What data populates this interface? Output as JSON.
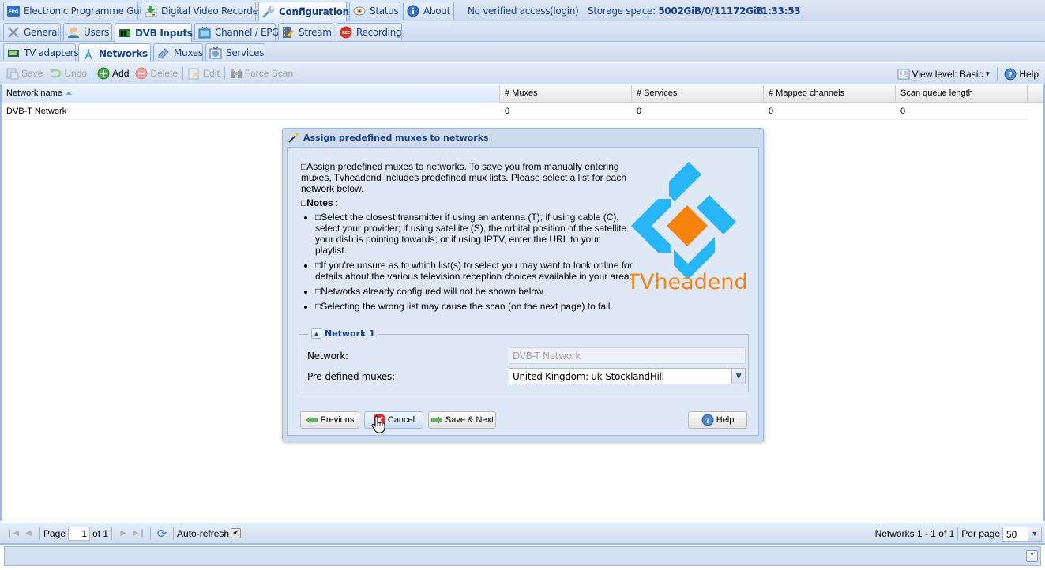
{
  "top_tabs": [
    {
      "label": "Electronic Programme Guide",
      "icon": "epg-icon",
      "active": false
    },
    {
      "label": "Digital Video Recorder",
      "icon": "download-icon",
      "active": false
    },
    {
      "label": "Configuration",
      "icon": "wrench-icon",
      "active": true
    },
    {
      "label": "Status",
      "icon": "eye-icon",
      "active": false
    },
    {
      "label": "About",
      "icon": "info-icon",
      "active": false
    }
  ],
  "status_bar": {
    "access": "No verified access",
    "login": "(login)",
    "storage_label": "Storage space:",
    "storage_value": "5002GiB/0/11172GiB",
    "time": "11:33:53"
  },
  "config_tabs": [
    {
      "label": "General",
      "icon": "tools-icon",
      "active": false
    },
    {
      "label": "Users",
      "icon": "users-icon",
      "active": false
    },
    {
      "label": "DVB Inputs",
      "icon": "dvb-card-icon",
      "active": true
    },
    {
      "label": "Channel / EPG",
      "icon": "tv-icon",
      "active": false
    },
    {
      "label": "Stream",
      "icon": "film-icon",
      "active": false
    },
    {
      "label": "Recording",
      "icon": "rec-icon",
      "active": false
    }
  ],
  "dvb_tabs": [
    {
      "label": "TV adapters",
      "icon": "adapter-icon",
      "active": false
    },
    {
      "label": "Networks",
      "icon": "antenna-icon",
      "active": true
    },
    {
      "label": "Muxes",
      "icon": "mux-icon",
      "active": false
    },
    {
      "label": "Services",
      "icon": "services-icon",
      "active": false
    }
  ],
  "toolbar": {
    "save": "Save",
    "undo": "Undo",
    "add": "Add",
    "delete": "Delete",
    "edit": "Edit",
    "force_scan": "Force Scan",
    "view_level": "View level: Basic",
    "help": "Help"
  },
  "grid": {
    "columns": [
      "Network name",
      "# Muxes",
      "# Services",
      "# Mapped channels",
      "Scan queue length"
    ],
    "sorted_column": "Network name",
    "rows": [
      [
        "DVB-T Network",
        "0",
        "0",
        "0",
        "0"
      ]
    ]
  },
  "paging": {
    "page_label": "Page",
    "page_value": "1",
    "of_label": "of 1",
    "auto_refresh": "Auto-refresh",
    "auto_refresh_checked": true,
    "summary": "Networks 1 - 1 of 1",
    "per_page_label": "Per page",
    "per_page_value": "50"
  },
  "dialog": {
    "title": "Assign predefined muxes to networks",
    "intro": "□Assign predefined muxes to networks. To save you from manually entering muxes, Tvheadend includes predefined mux lists. Please select a list for each network below.",
    "notes_prefix": "□",
    "notes_label": "Notes",
    "notes_suffix": " :",
    "notes": [
      "□Select the closest transmitter if using an antenna (T); if using cable (C), select your provider; if using satellite (S), the orbital position of the satellite your dish is pointing towards; or if using IPTV, enter the URL to your playlist.",
      "□If you're unsure as to which list(s) to select you may want to look online for details about the various television reception choices available in your area.",
      "□Networks already configured will not be shown below.",
      "□Selecting the wrong list may cause the scan (on the next page) to fail."
    ],
    "logo_text": "TVheadend",
    "fieldset_title": "Network 1",
    "network_label": "Network:",
    "network_value": "DVB-T Network",
    "muxes_label": "Pre-defined muxes:",
    "muxes_value": "United Kingdom: uk-StocklandHill",
    "buttons": {
      "previous": "Previous",
      "cancel": "Cancel",
      "save_next": "Save & Next",
      "help": "Help"
    }
  },
  "colors": {
    "logo_blue": "#29b6f6",
    "logo_orange": "#f7830f",
    "header_text": "#15428b",
    "panel_border": "#99bbe8"
  }
}
